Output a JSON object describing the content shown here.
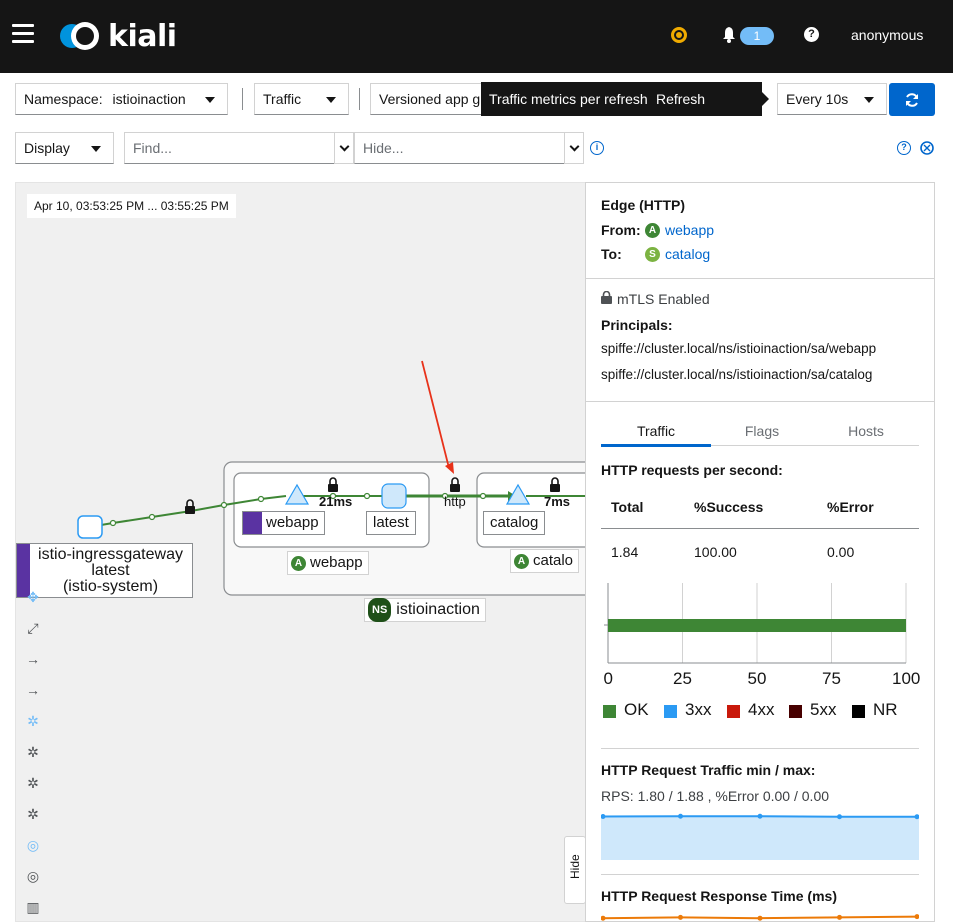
{
  "masthead": {
    "brand": "kiali",
    "notification_count": "1",
    "user": "anonymous",
    "help_symbol": "?",
    "colors": {
      "background": "#151515",
      "status": "#f0ab00",
      "badge": "#73bcf7"
    }
  },
  "toolbar": {
    "namespace_label": "Namespace:",
    "namespace_value": "istioinaction",
    "traffic_label": "Traffic",
    "graph_type_value": "Versioned app gr",
    "tooltip_metrics": "Traffic metrics per refresh",
    "tooltip_refresh": "Refresh interval",
    "refresh_interval": "Every 10s",
    "display_label": "Display",
    "find_placeholder": "Find...",
    "hide_placeholder": "Hide...",
    "accent": "#0066cc"
  },
  "graph": {
    "time_range": "Apr 10, 03:53:25 PM ... 03:55:25 PM",
    "nodes": {
      "gateway_name": "istio-ingressgateway",
      "gateway_version": "latest",
      "gateway_ns": "(istio-system)",
      "webapp_service": "webapp",
      "webapp_version": "latest",
      "webapp_app_badge": "A",
      "webapp_app": "webapp",
      "catalog_service": "catalog",
      "catalog_app_badge": "A",
      "catalog_app": "catalo",
      "namespace_badge": "NS",
      "namespace": "istioinaction"
    },
    "edges": {
      "webapp_latency": "21ms",
      "protocol": "http",
      "catalog_latency": "7ms"
    },
    "hide_label": "Hide",
    "edge_color": "#3e8635"
  },
  "panel": {
    "title": "Edge (HTTP)",
    "from_label": "From:",
    "from_badge": "A",
    "from_value": "webapp",
    "to_label": "To:",
    "to_badge": "S",
    "to_value": "catalog",
    "mtls": "mTLS Enabled",
    "principals_label": "Principals:",
    "principals": [
      "spiffe://cluster.local/ns/istioinaction/sa/webapp",
      "spiffe://cluster.local/ns/istioinaction/sa/catalog"
    ],
    "tabs": [
      "Traffic",
      "Flags",
      "Hosts"
    ],
    "rps_title": "HTTP requests per second:",
    "table": {
      "headers": [
        "Total",
        "%Success",
        "%Error"
      ],
      "row": [
        "1.84",
        "100.00",
        "0.00"
      ]
    },
    "min_max_title": "HTTP Request Traffic min / max:",
    "rps_line": "RPS: 1.80 / 1.88 , %Error 0.00 / 0.00",
    "response_time_title": "HTTP Request Response Time (ms)"
  },
  "chart_data": [
    {
      "type": "bar",
      "categories": [
        "OK",
        "3xx",
        "4xx",
        "5xx",
        "NR"
      ],
      "series": [
        {
          "name": "OK",
          "values": [
            100
          ]
        },
        {
          "name": "3xx",
          "values": [
            0
          ]
        },
        {
          "name": "4xx",
          "values": [
            0
          ]
        },
        {
          "name": "5xx",
          "values": [
            0
          ]
        },
        {
          "name": "NR",
          "values": [
            0
          ]
        }
      ],
      "ticks": [
        "0",
        "25",
        "50",
        "75",
        "100"
      ],
      "xlim": [
        0,
        100
      ],
      "colors": [
        "#3e8635",
        "#2b9af3",
        "#c9190b",
        "#470000",
        "#000000"
      ],
      "legend": "bottom",
      "grid": true
    },
    {
      "type": "area",
      "series": [
        {
          "values": [
            1.84,
            1.85,
            1.85,
            1.83,
            1.83
          ]
        }
      ],
      "ylim": [
        0,
        2.2
      ],
      "color": "#2b9af3"
    },
    {
      "type": "line",
      "series": [
        {
          "values": [
            0.6,
            0.7,
            0.6,
            0.7,
            0.8
          ]
        }
      ],
      "color": "#ec7a08"
    }
  ]
}
